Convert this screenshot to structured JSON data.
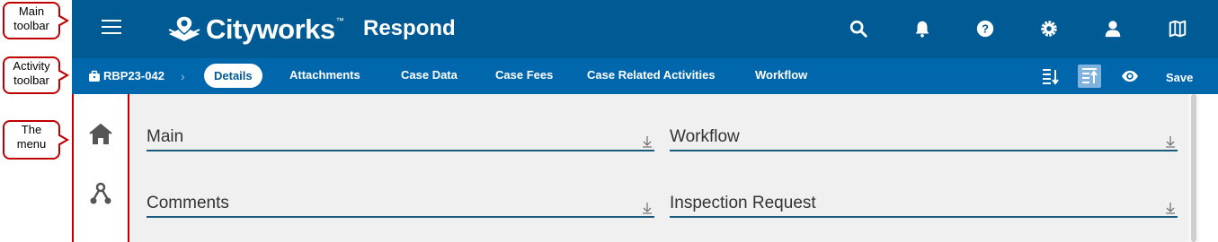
{
  "callouts": {
    "main_toolbar": "Main toolbar",
    "activity_toolbar": "Activity toolbar",
    "menu": "The menu"
  },
  "header": {
    "logo_text": "Cityworks",
    "logo_tm": "™",
    "app_name": "Respond",
    "icons": [
      "search-icon",
      "bell-icon",
      "help-icon",
      "settings-icon",
      "user-icon",
      "map-icon"
    ]
  },
  "activity": {
    "case_id": "RBP23-042",
    "tabs": [
      {
        "label": "Details",
        "active": true
      },
      {
        "label": "Attachments"
      },
      {
        "label": "Case Data"
      },
      {
        "label": "Case Fees"
      },
      {
        "label": "Case Related Activities"
      },
      {
        "label": "Workflow"
      }
    ],
    "save_label": "Save"
  },
  "menu": {
    "items": [
      "home-icon",
      "workflow-icon"
    ]
  },
  "panels": [
    {
      "title": "Main"
    },
    {
      "title": "Workflow"
    },
    {
      "title": "Comments"
    },
    {
      "title": "Inspection Request"
    }
  ],
  "colors": {
    "main_toolbar": "#005a94",
    "activity_toolbar": "#0067ad",
    "content_bg": "#f0f0f0",
    "callout_border": "#c00000"
  }
}
